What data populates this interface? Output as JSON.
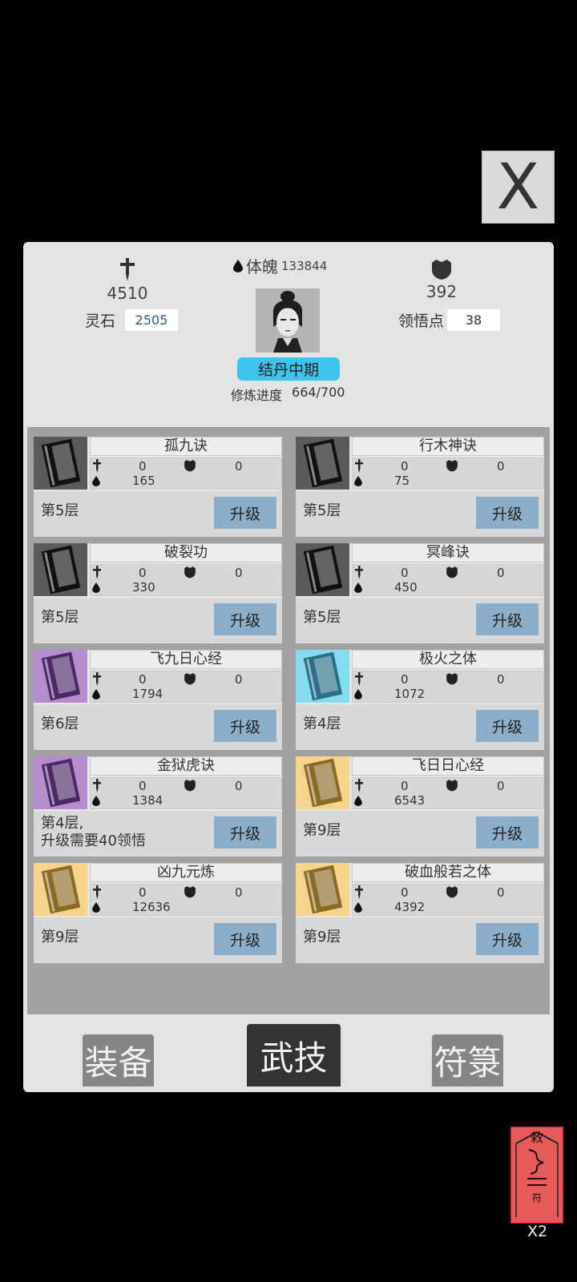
{
  "close": {
    "label": "X"
  },
  "header": {
    "attack": {
      "icon": "sword-icon",
      "value": "4510"
    },
    "body": {
      "icon": "blood-drop-icon",
      "label": "体魄",
      "value": "133844"
    },
    "defense": {
      "icon": "shield-icon",
      "value": "392"
    },
    "spirit_stone": {
      "label": "灵石",
      "value": "2505"
    },
    "insight": {
      "label": "领悟点",
      "value": "38"
    },
    "realm": "结丹中期",
    "progress_label": "修炼进度",
    "progress_value": "664/700"
  },
  "skills": [
    {
      "name": "孤九诀",
      "atk": "0",
      "def": "0",
      "hp": "165",
      "level": "第5层",
      "upgrade": "升级",
      "book_color": "#5a5a5a",
      "spine": "#111"
    },
    {
      "name": "行木神诀",
      "atk": "0",
      "def": "0",
      "hp": "75",
      "level": "第5层",
      "upgrade": "升级",
      "book_color": "#5a5a5a",
      "spine": "#111"
    },
    {
      "name": "破裂功",
      "atk": "0",
      "def": "0",
      "hp": "330",
      "level": "第5层",
      "upgrade": "升级",
      "book_color": "#5a5a5a",
      "spine": "#111"
    },
    {
      "name": "冥峰诀",
      "atk": "0",
      "def": "0",
      "hp": "450",
      "level": "第5层",
      "upgrade": "升级",
      "book_color": "#5a5a5a",
      "spine": "#111"
    },
    {
      "name": "飞九日心经",
      "atk": "0",
      "def": "0",
      "hp": "1794",
      "level": "第6层",
      "upgrade": "升级",
      "book_color": "#b78ccf",
      "spine": "#4b2866"
    },
    {
      "name": "极火之体",
      "atk": "0",
      "def": "0",
      "hp": "1072",
      "level": "第4层",
      "upgrade": "升级",
      "book_color": "#86dbf0",
      "spine": "#2a6f87"
    },
    {
      "name": "金狱虎诀",
      "atk": "0",
      "def": "0",
      "hp": "1384",
      "level": "第4层,",
      "level2": "升级需要40领悟",
      "upgrade": "升级",
      "book_color": "#b78ccf",
      "spine": "#4b2866"
    },
    {
      "name": "飞日日心经",
      "atk": "0",
      "def": "0",
      "hp": "6543",
      "level": "第9层",
      "upgrade": "升级",
      "book_color": "#f5d58c",
      "spine": "#8a6a25"
    },
    {
      "name": "凶九元炼",
      "atk": "0",
      "def": "0",
      "hp": "12636",
      "level": "第9层",
      "upgrade": "升级",
      "book_color": "#f5d58c",
      "spine": "#8a6a25"
    },
    {
      "name": "破血般若之体",
      "atk": "0",
      "def": "0",
      "hp": "4392",
      "level": "第9层",
      "upgrade": "升级",
      "book_color": "#f5d58c",
      "spine": "#8a6a25"
    }
  ],
  "tabs": [
    {
      "label": "装备",
      "active": false
    },
    {
      "label": "武技",
      "active": true
    },
    {
      "label": "符箓",
      "active": false
    }
  ],
  "talisman": {
    "icon": "talisman-scroll-icon",
    "multiplier": "X2"
  },
  "colors": {
    "realm_badge": "#3ec3ea",
    "upgrade_button": "#8daec9",
    "talisman": "#e85a5a"
  }
}
